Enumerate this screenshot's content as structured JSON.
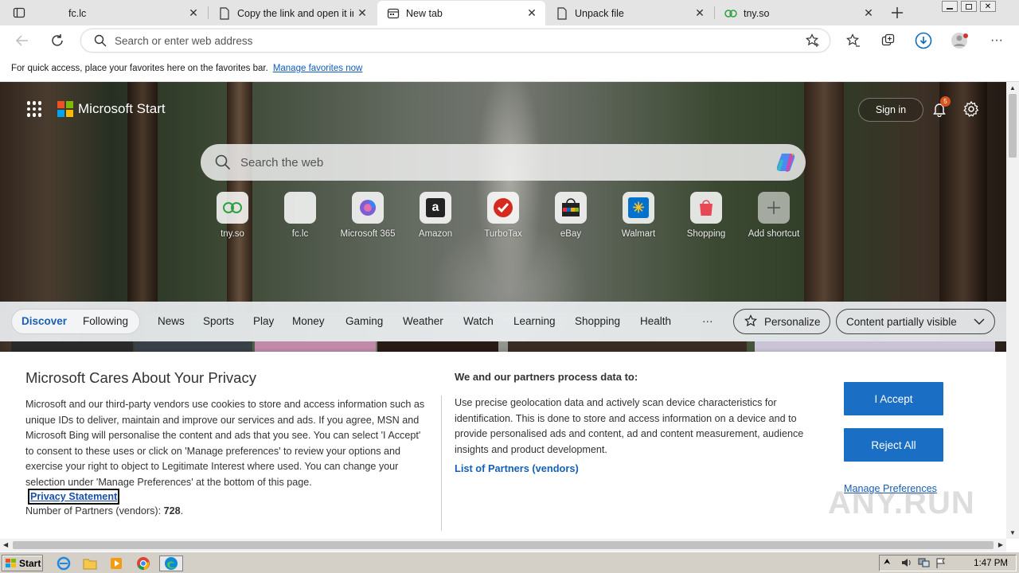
{
  "browser": {
    "tabs": [
      {
        "label": "fc.lc",
        "icon": "blank-page-icon"
      },
      {
        "label": "Copy the link and open it in",
        "icon": "page-icon"
      },
      {
        "label": "New tab",
        "icon": "newtab-icon",
        "active": true
      },
      {
        "label": "Unpack file",
        "icon": "page-icon"
      },
      {
        "label": "tny.so",
        "icon": "link-icon"
      }
    ],
    "address_placeholder": "Search or enter web address",
    "favbar_text": "For quick access, place your favorites here on the favorites bar.",
    "favbar_link": "Manage favorites now"
  },
  "start": {
    "brand": "Microsoft Start",
    "signin": "Sign in",
    "notif_count": "5",
    "search_placeholder": "Search the web",
    "shortcuts": [
      {
        "label": "tny.so",
        "icon": "link-icon"
      },
      {
        "label": "fc.lc",
        "icon": "blank-icon"
      },
      {
        "label": "Microsoft 365",
        "icon": "m365-icon"
      },
      {
        "label": "Amazon",
        "icon": "amazon-icon"
      },
      {
        "label": "TurboTax",
        "icon": "turbotax-icon"
      },
      {
        "label": "eBay",
        "icon": "ebay-icon"
      },
      {
        "label": "Walmart",
        "icon": "walmart-icon"
      },
      {
        "label": "Shopping",
        "icon": "shopping-icon"
      },
      {
        "label": "Add shortcut",
        "icon": "plus-icon"
      }
    ],
    "nav": {
      "discover": "Discover",
      "following": "Following",
      "items": [
        "News",
        "Sports",
        "Play",
        "Money",
        "Gaming",
        "Weather",
        "Watch",
        "Learning",
        "Shopping",
        "Health"
      ],
      "more": "···",
      "personalize": "Personalize",
      "content_visibility": "Content partially visible"
    }
  },
  "privacy": {
    "title": "Microsoft Cares About Your Privacy",
    "body": "Microsoft and our third-party vendors use cookies to store and access information such as unique IDs to deliver, maintain and improve our services and ads. If you agree, MSN and Microsoft Bing will personalise the content and ads that you see. You can select 'I Accept' to consent to these uses or click on 'Manage preferences' to review your options and exercise your right to object to Legitimate Interest where used.  You can change your selection under 'Manage Preferences' at the bottom of this page.",
    "statement_link": "Privacy Statement",
    "partners_label": "Number of Partners (vendors):",
    "partners_count": "728",
    "partners_suffix": ".",
    "right_title": "We and our partners process data to:",
    "right_body": "Use precise geolocation data and actively scan device characteristics for identification. This is done to store and access information on a device and to provide personalised ads and content, ad and content measurement, audience insights and product development.",
    "vendors_link": "List of Partners (vendors)",
    "accept": "I Accept",
    "reject": "Reject All",
    "manage": "Manage Preferences"
  },
  "watermark": "ANY.RUN",
  "taskbar": {
    "start": "Start",
    "clock": "1:47 PM"
  },
  "colors": {
    "accent": "#1a6fc4",
    "link": "#0f5cbf"
  }
}
